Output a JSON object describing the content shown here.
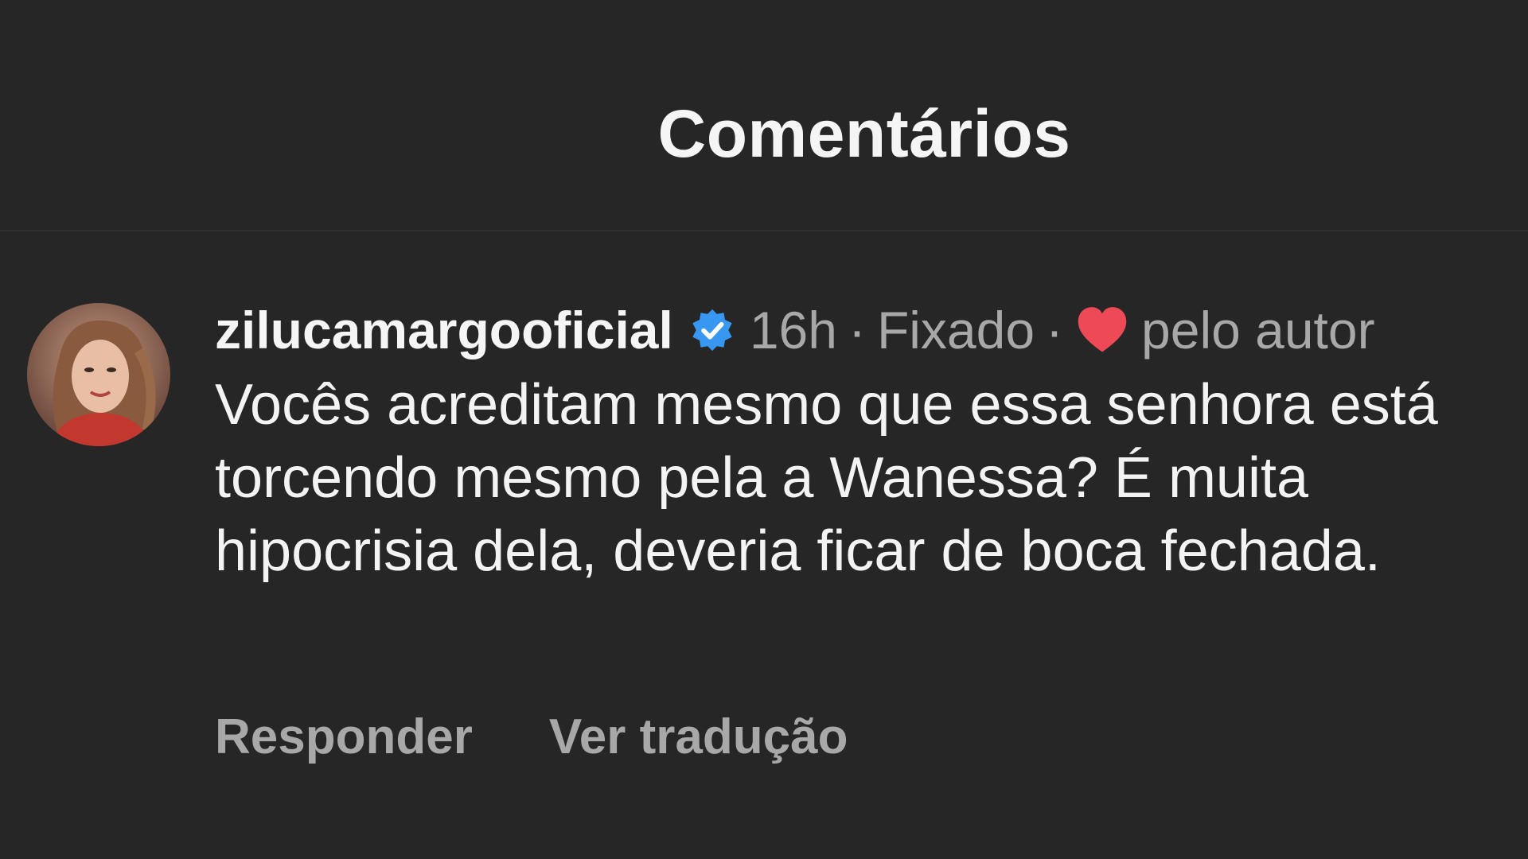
{
  "header": {
    "title": "Comentários"
  },
  "comment": {
    "username": "zilucamargooficial",
    "verified_icon": "verified-badge-icon",
    "time": "16h",
    "separator": "·",
    "pinned_label": "Fixado",
    "liked_by_author_icon": "heart-icon",
    "liked_by_author_label": "pelo autor",
    "text": "Vocês acreditam mesmo que essa senhora está torcendo mesmo pela a Wanessa? É muita hipocrisia dela, deveria ficar de boca fechada.",
    "reply_label": "Responder",
    "translate_label": "Ver tradução"
  },
  "colors": {
    "background": "#262626",
    "primary_text": "#f3f3f3",
    "secondary_text": "#a8a8a8",
    "verified_blue": "#3897f0",
    "heart_red": "#ed4956"
  }
}
